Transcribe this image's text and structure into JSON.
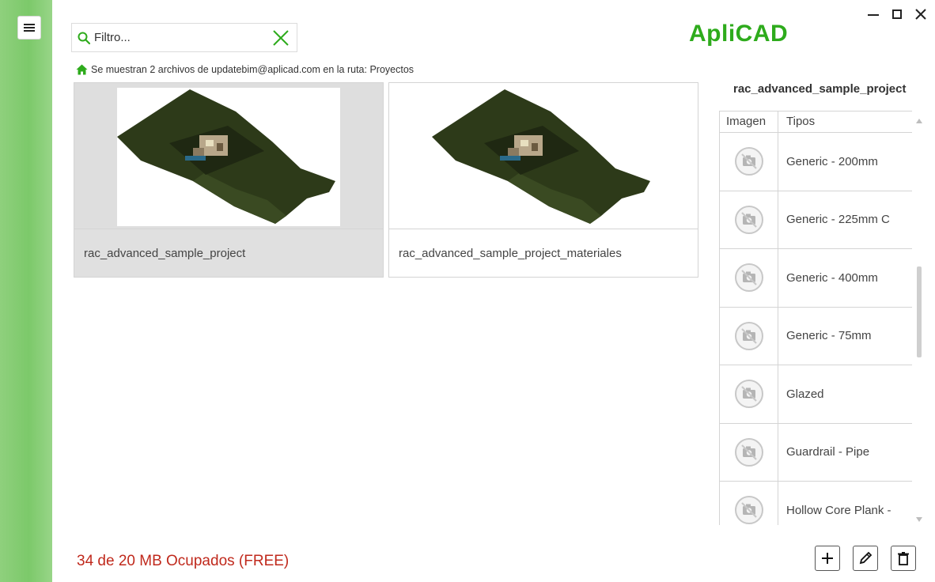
{
  "app": {
    "brand": "ApliCAD"
  },
  "search": {
    "placeholder": "Filtro...",
    "value": ""
  },
  "path_line": {
    "text": "Se muestran 2 archivos de updatebim@aplicad.com en la ruta: Proyectos"
  },
  "files": [
    {
      "name": "rac_advanced_sample_project",
      "selected": true
    },
    {
      "name": "rac_advanced_sample_project_materiales",
      "selected": false
    }
  ],
  "details": {
    "title": "rac_advanced_sample_project",
    "columns": {
      "image": "Imagen",
      "types": "Tipos"
    },
    "rows": [
      {
        "name": "Generic - 200mm"
      },
      {
        "name": "Generic - 225mm C"
      },
      {
        "name": "Generic - 400mm"
      },
      {
        "name": "Generic - 75mm"
      },
      {
        "name": "Glazed"
      },
      {
        "name": "Guardrail - Pipe"
      },
      {
        "name": "Hollow Core Plank -"
      }
    ]
  },
  "footer": {
    "usage": "34 de 20  MB Ocupados (FREE)"
  },
  "icons": {
    "menu": "hamburger-icon",
    "search": "search-icon",
    "clear": "close-icon",
    "home": "home-icon",
    "no_image": "no-camera-icon",
    "add": "plus-icon",
    "edit": "pencil-icon",
    "delete": "trash-icon",
    "minimize": "minimize-icon",
    "maximize": "maximize-icon",
    "close": "close-window-icon"
  },
  "colors": {
    "accent": "#2eab1c",
    "rail": "#7cc96a",
    "usage_text": "#c0291c"
  }
}
